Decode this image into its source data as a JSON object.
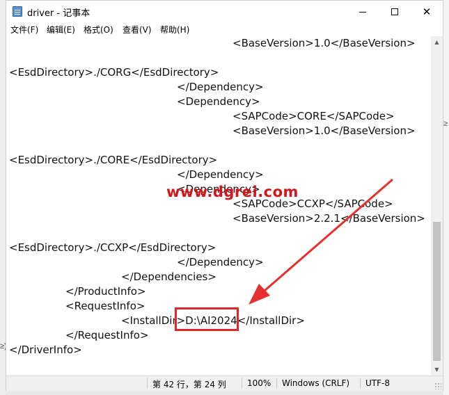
{
  "window": {
    "title": "driver - 记事本",
    "minimize_label": "—",
    "maximize_label": "□",
    "close_label": "✕"
  },
  "menu": {
    "items": [
      {
        "label": "文件(F)"
      },
      {
        "label": "编辑(E)"
      },
      {
        "label": "格式(O)"
      },
      {
        "label": "查看(V)"
      },
      {
        "label": "帮助(H)"
      }
    ]
  },
  "editor": {
    "lines": [
      {
        "text": "<BaseVersion>1.0</BaseVersion>"
      },
      {
        "text": ""
      },
      {
        "text": "<EsdDirectory>./CORG</EsdDirectory>"
      },
      {
        "text": "</Dependency>"
      },
      {
        "text": "<Dependency>"
      },
      {
        "text": "<SAPCode>CORE</SAPCode>"
      },
      {
        "text": "<BaseVersion>1.0</BaseVersion>"
      },
      {
        "text": ""
      },
      {
        "text": "<EsdDirectory>./CORE</EsdDirectory>"
      },
      {
        "text": "</Dependency>"
      },
      {
        "text": "<Dependency>"
      },
      {
        "text": "<SAPCode>CCXP</SAPCode>"
      },
      {
        "text": "<BaseVersion>2.2.1</BaseVersion>"
      },
      {
        "text": ""
      },
      {
        "text": "<EsdDirectory>./CCXP</EsdDirectory>"
      },
      {
        "text": "</Dependency>"
      },
      {
        "text": "</Dependencies>"
      },
      {
        "text": "</ProductInfo>"
      },
      {
        "text": "<RequestInfo>"
      },
      {
        "text": "<InstallDir>D:\\AI2024</InstallDir>"
      },
      {
        "text": "</RequestInfo>"
      },
      {
        "text": "</DriverInfo>"
      }
    ]
  },
  "status": {
    "position": "第 42 行，第 24 列",
    "zoom": "100%",
    "line_ending": "Windows (CRLF)",
    "encoding": "UTF-8"
  },
  "annotation": {
    "watermark": "www.dgrei.com",
    "highlight_color": "#e0262a"
  },
  "background": {
    "right_mark": "≥",
    "left_mark": "≥)"
  }
}
